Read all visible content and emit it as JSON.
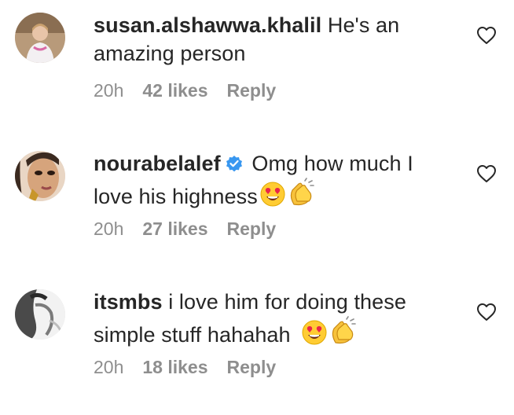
{
  "comments": [
    {
      "username": "susan.alshawwa.khalil",
      "text": "He's an amazing person",
      "verified": false,
      "emojis": [],
      "time": "20h",
      "likes": "42 likes",
      "reply": "Reply"
    },
    {
      "username": "nourabelalef",
      "text": "Omg how much I love his highness",
      "verified": true,
      "emojis": [
        "heart-eyes-emoji",
        "clapping-hands-emoji"
      ],
      "time": "20h",
      "likes": "27 likes",
      "reply": "Reply"
    },
    {
      "username": "itsmbs",
      "text": "i love him for doing these simple stuff hahahah",
      "verified": false,
      "emojis": [
        "heart-eyes-emoji",
        "clapping-hands-emoji"
      ],
      "time": "20h",
      "likes": "18 likes",
      "reply": "Reply"
    }
  ],
  "icons": {
    "like": "heart-outline-icon",
    "verified": "verified-badge-icon"
  },
  "colors": {
    "text": "#262626",
    "meta": "#8e8e8e",
    "verified": "#3897f0"
  }
}
